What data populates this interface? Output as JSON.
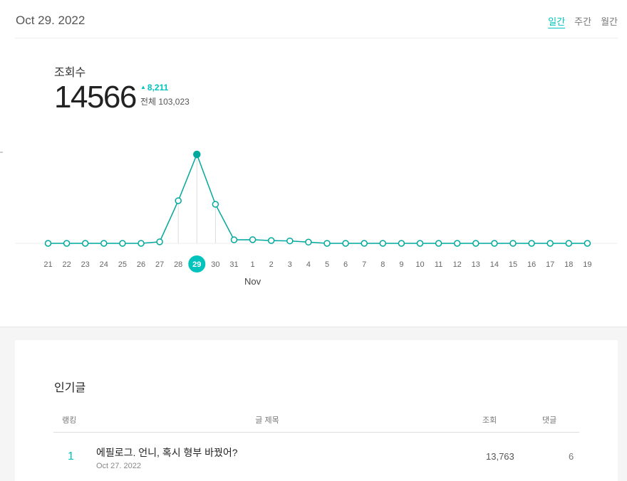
{
  "header": {
    "date": "Oct 29. 2022",
    "tabs": [
      {
        "label": "일간",
        "active": true
      },
      {
        "label": "주간",
        "active": false
      },
      {
        "label": "월간",
        "active": false
      }
    ]
  },
  "stats": {
    "label": "조회수",
    "value": "14566",
    "delta": "8,211",
    "total": "전체 103,023"
  },
  "colors": {
    "accent": "#00c3bd",
    "line": "#00a99d"
  },
  "chart_data": {
    "type": "line",
    "x": [
      "21",
      "22",
      "23",
      "24",
      "25",
      "26",
      "27",
      "28",
      "29",
      "30",
      "31",
      "1",
      "2",
      "3",
      "4",
      "5",
      "6",
      "7",
      "8",
      "9",
      "10",
      "11",
      "12",
      "13",
      "14",
      "15",
      "16",
      "17",
      "18",
      "19"
    ],
    "values": [
      0,
      0,
      0,
      0,
      0,
      0,
      250,
      6980,
      14566,
      6400,
      580,
      600,
      450,
      400,
      200,
      0,
      0,
      0,
      0,
      0,
      0,
      0,
      0,
      0,
      0,
      0,
      0,
      0,
      0,
      0
    ],
    "highlight_index": 8,
    "month_label": "Nov",
    "month_label_index": 11,
    "ylim": [
      0,
      14566
    ],
    "grid": false
  },
  "popular": {
    "title": "인기글",
    "headers": {
      "rank": "랭킹",
      "title": "글 제목",
      "views": "조회",
      "comments": "댓글"
    },
    "rows": [
      {
        "rank": "1",
        "title": "에필로그. 언니, 혹시 형부 바꿨어?",
        "date": "Oct 27. 2022",
        "views": "13,763",
        "comments": "6"
      }
    ]
  }
}
